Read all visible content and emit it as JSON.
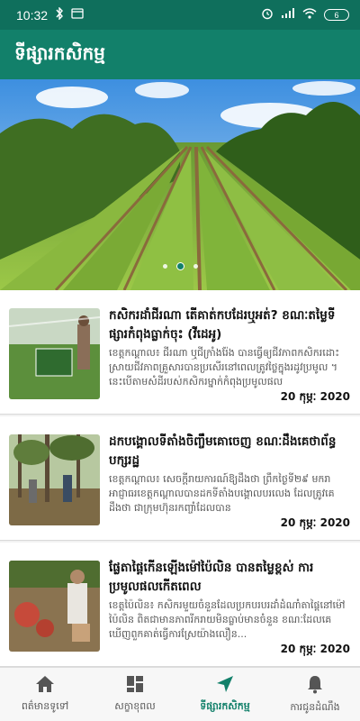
{
  "status_bar": {
    "time": "10:32",
    "battery": "6",
    "icons": [
      "bluetooth-icon",
      "screen-cast-icon",
      "alarm-icon",
      "signal-icon",
      "wifi-icon",
      "battery-icon"
    ]
  },
  "app_bar": {
    "title": "ទីផ្សារកសិកម្ម"
  },
  "banner": {
    "image": "vegetable-farm-rows",
    "active_slide": 2,
    "slide_count": 3
  },
  "articles": [
    {
      "title": "កសិករដាំជីរណា តើគាត់កបដែរឬអត់? ខណៈតម្លៃទីផ្សារកំពុងធ្លាក់ចុះ (វីដេអូ)",
      "excerpt": "ខេត្តកណ្ដាល៖ ជីរណា ឬជីក្រាំងរ៉ែង បានធ្វើឲ្យជីវភាពកសិករដោះស្រាយជីវភាពគ្រួសារបានប្រសើរនៅពេលត្រូវថ្លៃក្នុងរដូវប្រមូល ។ នេះបើតាមសំដីរបស់កសិករម្នាក់កំពុងប្រមូលផល",
      "date": "20 កុម្ភៈ 2020",
      "thumb": "herb-harvest-photo"
    },
    {
      "title": "ដកបង្គោលទីតាំងចិញ្ចឹមគោចេញ ខណៈដឹងគេថាព័ន្ធបក្សរដ្ឋ",
      "excerpt": "ខេត្តកណ្ដាល៖ សេចក្ដីរាយការណ៍ឱ្យដឹងថា ព្រឹកថ្ងៃទី២៩ មករា អាជ្ញាធរខេត្តកណ្ដាលបានដកទីតាំងបង្គោលបរលេង ដែលត្រូវគេដឹងថា ជាក្រុមហ៊ុនរកញ្ចាំដែលបាន",
      "date": "20 កុម្ភៈ 2020",
      "thumb": "forest-field-photo"
    },
    {
      "title": "ផ្លែតាផ្ដៃកើនឡើងម៉ៅប៉ៃលិន បានតម្លៃខ្ពស់ ការប្រមូលផលកើតពេល",
      "excerpt": "ខេត្តប៉ៃលិន៖ កសិករមួយចំនួនដែលប្រកបរបរដាំដំណាំតាផ្ដៃនៅម៉ៅប៉ៃលិន ពិតជាមានភាពរីករាយមិនធ្លាប់មានចំនួន ខណៈដែលគេឃើញពួកគាត់ធ្វើការស្រែយ៉ាងលឿន...",
      "date": "20 កុម្ភៈ 2020",
      "thumb": "farmer-harvest-photo"
    }
  ],
  "bottom_nav": [
    {
      "label": "ពត៌មានទូទៅ",
      "icon": "home-icon",
      "active": false
    },
    {
      "label": "សក្ខាខុពល",
      "icon": "dashboard-icon",
      "active": false
    },
    {
      "label": "ទីផ្សារកសិកម្ម",
      "icon": "navigation-arrow-icon",
      "active": true
    },
    {
      "label": "ការជូនដំណឹង",
      "icon": "bell-icon",
      "active": false
    }
  ],
  "colors": {
    "primary": "#12806a",
    "status_bar": "#0f6f5c",
    "text": "#111111",
    "muted": "#555555"
  }
}
